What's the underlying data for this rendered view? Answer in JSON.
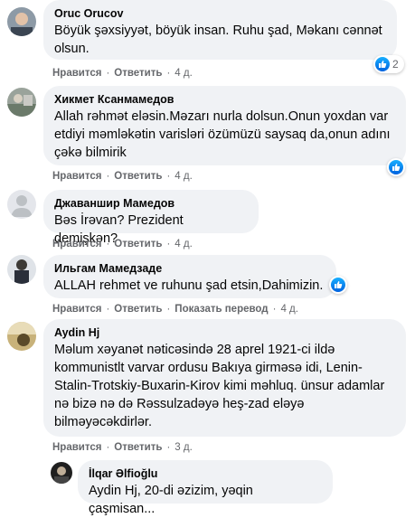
{
  "comments": [
    {
      "author": "Oruc Orucov",
      "text": "Böyük şəxsiyyət, böyük insan. Ruhu şad, Məkanı cənnət olsun.",
      "like": "Нравится",
      "reply": "Ответить",
      "time": "4 д.",
      "reactions": "2"
    },
    {
      "author": "Хикмет Ксанмамедов",
      "text": "Allah rəhmət eləsin.Məzarı nurla dolsun.Onun yoxdan var etdiyi məmləkətin varisləri özümüzü saysaq da,onun adını çəkə bilmirik",
      "like": "Нравится",
      "reply": "Ответить",
      "time": "4 д."
    },
    {
      "author": "Джаваншир Мамедов",
      "text": "Bəs İrəvan? Prezident demişkən?",
      "like": "Нравится",
      "reply": "Ответить",
      "time": "4 д."
    },
    {
      "author": "Ильгам Мамедзаде",
      "text": "ALLAH rehmet ve ruhunu şad etsin,Dahimizin.",
      "like": "Нравится",
      "reply": "Ответить",
      "translate": "Показать перевод",
      "time": "4 д."
    },
    {
      "author": "Aydin Hj",
      "text": "Məlum xəyanət nəticəsində 28 aprel 1921-ci ildə kommunistlt varvar ordusu Bakıya girməsə idi, Lenin-Stalin-Trotskiy-Buxarin-Kirov kimi məhluq. ünsur adamlar nə bizə nə də Rəssulzadəyə heş-zad eləyə bilməyəcəkdirlər.",
      "like": "Нравится",
      "reply": "Ответить",
      "time": "3 д."
    }
  ],
  "reply": {
    "author": "İlqar Əlfioğlu",
    "text": "Aydin Hj, 20-di əzizim, yəqin çaşmisan..."
  },
  "colors": {
    "bubble": "#f0f2f5",
    "meta": "#65676b",
    "like_blue": "#1877f2"
  }
}
